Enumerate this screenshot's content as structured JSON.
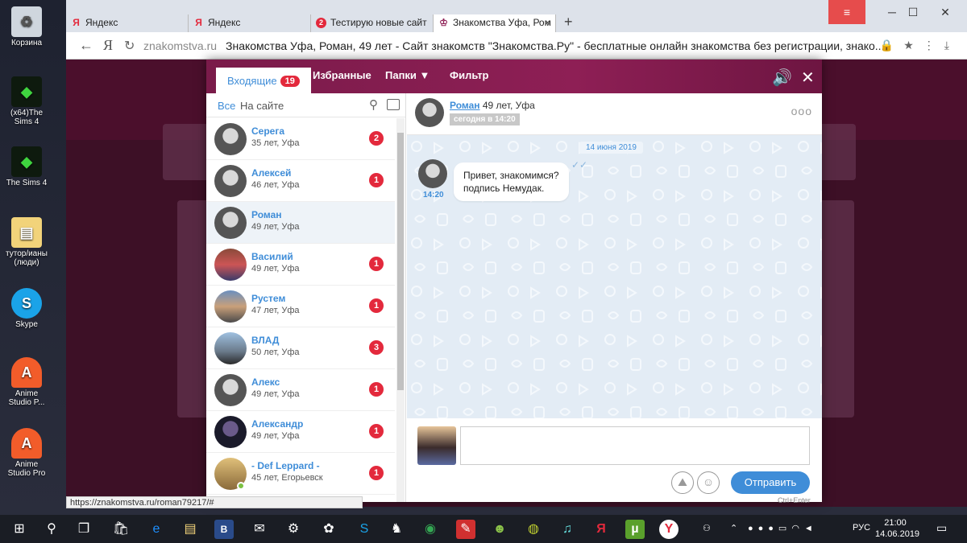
{
  "desktop": {
    "icons": [
      {
        "label": "Корзина",
        "icon": "recycle-bin-icon"
      },
      {
        "label": "(x64)The Sims 4",
        "icon": "sims-icon"
      },
      {
        "label": "The Sims 4",
        "icon": "sims-icon"
      },
      {
        "label": "тутор/ианы (люди)",
        "icon": "folder-icon"
      },
      {
        "label": "Skype",
        "icon": "skype-icon"
      },
      {
        "label": "Anime Studio P...",
        "icon": "anime-studio-icon"
      },
      {
        "label": "Anime Studio Pro",
        "icon": "anime-studio-icon"
      }
    ]
  },
  "browser": {
    "tabs": [
      {
        "label": "Яндекс",
        "favicon": "Я"
      },
      {
        "label": "Яндекс",
        "favicon": "Я"
      },
      {
        "label": "Тестирую новые сайт",
        "favicon": "2"
      },
      {
        "label": "Знакомства Уфа, Ром",
        "favicon": "♔"
      }
    ],
    "new_tab": "+",
    "menu_icon": "≡",
    "address": {
      "domain": "znakomstva.ru",
      "title": "Знакомства Уфа, Роман, 49 лет - Сайт знакомств \"Знакомства.Ру\" - бесплатные онлайн знакомства без регистрации, знако..."
    },
    "status_url": "https://znakomstva.ru/roman79217/#"
  },
  "modal": {
    "tabs": {
      "inbox": "Входящие",
      "inbox_count": "19",
      "favorites": "Избранные",
      "folders": "Папки ▼",
      "filter": "Фильтр"
    },
    "filter": {
      "all": "Все",
      "on_site": "На сайте"
    },
    "contacts": [
      {
        "name": "Серега",
        "info": "35 лет, Уфа",
        "unread": "2"
      },
      {
        "name": "Алексей",
        "info": "46 лет, Уфа",
        "unread": "1"
      },
      {
        "name": "Роман",
        "info": "49 лет, Уфа",
        "unread": ""
      },
      {
        "name": "Василий",
        "info": "49 лет, Уфа",
        "unread": "1"
      },
      {
        "name": "Рустем",
        "info": "47 лет, Уфа",
        "unread": "1"
      },
      {
        "name": "ВЛАД",
        "info": "50 лет, Уфа",
        "unread": "3"
      },
      {
        "name": "Алекс",
        "info": "49 лет, Уфа",
        "unread": "1"
      },
      {
        "name": "Александр",
        "info": "49 лет, Уфа",
        "unread": "1"
      },
      {
        "name": "- Def Leppard -",
        "info": "45 лет, Егорьевск",
        "unread": "1"
      }
    ],
    "chat": {
      "name": "Роман",
      "info": "49 лет, Уфа",
      "status": "сегодня в 14:20",
      "more": "ooo",
      "date": "14 июня 2019",
      "ticks": "✓✓",
      "message_line1": "Привет, знакомимся?",
      "message_line2": "подпись Немудак.",
      "message_time": "14:20",
      "send": "Отправить",
      "send_hint": "Ctrl+Enter"
    }
  },
  "taskbar": {
    "language": "РУС",
    "time": "21:00",
    "date": "14.06.2019"
  },
  "colors": {
    "accent": "#3f8dd8",
    "badge": "#e3293c",
    "header": "#8e1f55"
  }
}
